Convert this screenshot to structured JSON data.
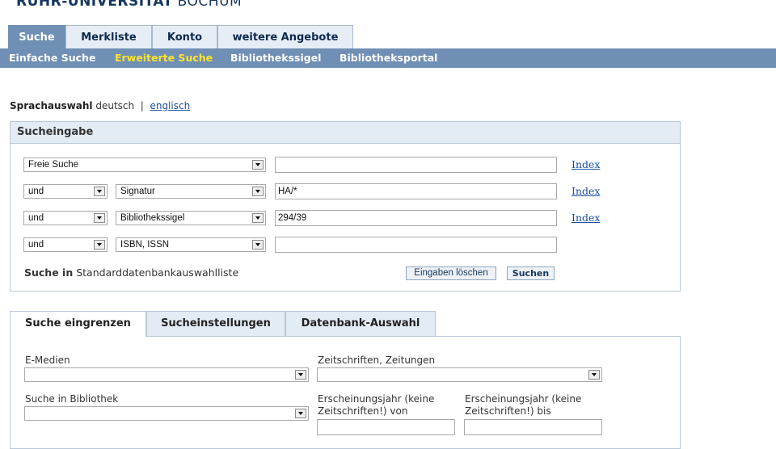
{
  "header": {
    "logo_bold": "RUHR-UNIVERSITÄT",
    "logo_light": "BOCHUM"
  },
  "tabs": [
    {
      "label": "Suche",
      "active": true
    },
    {
      "label": "Merkliste"
    },
    {
      "label": "Konto"
    },
    {
      "label": "weitere Angebote"
    }
  ],
  "subnav": [
    {
      "label": "Einfache Suche"
    },
    {
      "label": "Erweiterte Suche",
      "current": true
    },
    {
      "label": "Bibliothekssigel"
    },
    {
      "label": "Bibliotheksportal"
    }
  ],
  "language": {
    "label": "Sprachauswahl",
    "current": "deutsch",
    "separator": "|",
    "other": "englisch"
  },
  "search": {
    "title": "Sucheingabe",
    "rows": [
      {
        "field": "Freie Suche",
        "value": "",
        "index": "Index"
      },
      {
        "operator": "und",
        "field": "Signatur",
        "value": "HA/*",
        "index": "Index"
      },
      {
        "operator": "und",
        "field": "Bibliothekssigel",
        "value": "294/39",
        "index": "Index"
      },
      {
        "operator": "und",
        "field": "ISBN, ISSN",
        "value": ""
      }
    ],
    "scope_label": "Suche in",
    "scope_value": "Standarddatenbankauswahlliste",
    "clear_button": "Eingaben löschen",
    "search_button": "Suchen"
  },
  "filter_tabs": [
    {
      "label": "Suche eingrenzen",
      "active": true
    },
    {
      "label": "Sucheinstellungen"
    },
    {
      "label": "Datenbank-Auswahl"
    }
  ],
  "filters": {
    "emedien_label": "E-Medien",
    "zeitschriften_label": "Zeitschriften, Zeitungen",
    "bibliothek_label": "Suche in Bibliothek",
    "jahr_von_label_1": "Erscheinungsjahr (keine",
    "jahr_von_label_2": "Zeitschriften!) von",
    "jahr_bis_label_1": "Erscheinungsjahr (keine",
    "jahr_bis_label_2": "Zeitschriften!)  bis"
  }
}
